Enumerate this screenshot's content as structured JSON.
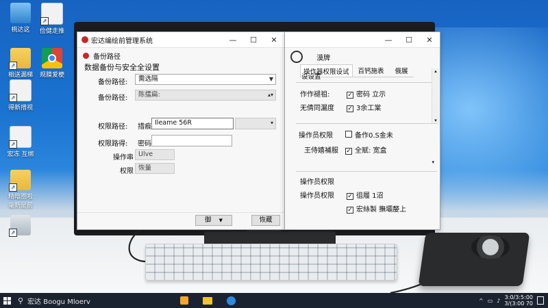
{
  "desktop": {
    "icons": [
      {
        "label": "桃达这",
        "glyph": "g-pc"
      },
      {
        "label": "俭健走推",
        "glyph": "g-doc"
      },
      {
        "label": "相送漏梯",
        "glyph": "g-folder"
      },
      {
        "label": "规膜爱梗",
        "glyph": "g-chrome"
      },
      {
        "label": "得新措视",
        "glyph": "g-doc"
      },
      {
        "label": "宏冻 互绑",
        "glyph": "g-doc"
      },
      {
        "label": "精暗圈啦\n毫新是前",
        "glyph": "g-folder"
      },
      {
        "label": "",
        "glyph": "g-usb"
      }
    ]
  },
  "main_window": {
    "title": "宏达编绘前管理系统",
    "section_heading": "备份路径",
    "subtitle": "数据备份与安全全设置",
    "fields": [
      {
        "label": "备份路径:",
        "value": "需选隔",
        "type": "dropdown"
      },
      {
        "label": "备份路径:",
        "value": "陈擂扁:",
        "type": "dropdown-gray"
      },
      {
        "label": "权限路径:",
        "prefix": "措痕",
        "value": "Ileame 56R",
        "type": "dropdown"
      },
      {
        "label": "权限路得:",
        "prefix": "密码",
        "value": "",
        "type": "input"
      }
    ],
    "readonly": [
      {
        "label": "操作串",
        "value": "Ulve"
      },
      {
        "label": "权限",
        "value": "恢量"
      }
    ],
    "buttons": {
      "secondary": "御",
      "primary": "恢藏"
    },
    "controls": {
      "minimize": "—",
      "maximize": "☐",
      "close": "✕"
    }
  },
  "perm_window": {
    "header_label": "漠牌",
    "tabs": [
      "操作器权限设试",
      "百钙施表",
      "俄展"
    ],
    "tab_subtitle": "设设置",
    "group1": [
      {
        "label": "作作褪祖:",
        "checked": true,
        "text": "密码 立示"
      },
      {
        "label": "无倩同漏度",
        "checked": true,
        "text": "3余工棠"
      }
    ],
    "group2": {
      "title": "操作员权限",
      "rows": [
        {
          "checked": false,
          "text": "备作0.S金未"
        },
        {
          "label": "王侍嬉補服",
          "checked": true,
          "text": "全赋: 宽盒"
        }
      ]
    },
    "group3": {
      "title": "操作员权限",
      "label": "操作员权限",
      "rows": [
        {
          "checked": true,
          "text": "徂履 1沼"
        },
        {
          "checked": true,
          "text": "宏絲製 撫壩嫠上"
        }
      ]
    },
    "controls": {
      "minimize": "—",
      "maximize": "☐",
      "close": "✕"
    }
  },
  "taskbar": {
    "search_text": "宏达 Boogu Mloerv",
    "clock_time": "3:0/3:5:00",
    "clock_date": "3/(3:00 70"
  }
}
